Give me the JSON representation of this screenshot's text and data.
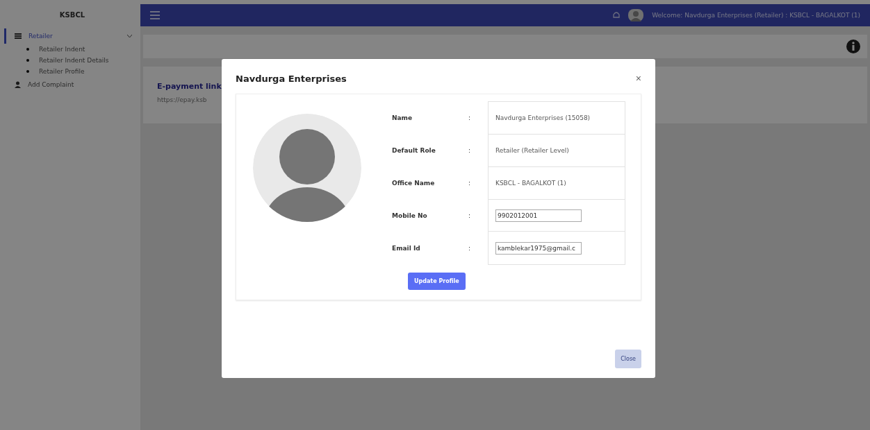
{
  "sidebar": {
    "brand": "KSBCL",
    "items": [
      {
        "label": "Retailer",
        "kind": "group",
        "expanded": true,
        "selected": true,
        "children": [
          {
            "label": "Retailer Indent"
          },
          {
            "label": "Retailer Indent Details"
          },
          {
            "label": "Retailer Profile"
          }
        ]
      },
      {
        "label": "Add Complaint",
        "kind": "link",
        "selected": false
      }
    ]
  },
  "topbar": {
    "welcome": "Welcome: Navdurga Enterprises (Retailer) : KSBCL - BAGALKOT (1)"
  },
  "card": {
    "title": "E-payment link",
    "link": "https://epay.ksb"
  },
  "modal": {
    "title": "Navdurga Enterprises",
    "close": "×",
    "fields": [
      {
        "label": "Name",
        "sep": ":",
        "kind": "text",
        "value": "Navdurga Enterprises (15058)"
      },
      {
        "label": "Default Role",
        "sep": ":",
        "kind": "text",
        "value": "Retailer (Retailer Level)"
      },
      {
        "label": "Office Name",
        "sep": ":",
        "kind": "text",
        "value": "KSBCL - BAGALKOT (1)"
      },
      {
        "label": "Mobile No",
        "sep": ":",
        "kind": "input",
        "value": "9902012001"
      },
      {
        "label": "Email Id",
        "sep": ":",
        "kind": "input",
        "value": "kamblekar1975@gmail.c"
      }
    ],
    "update_button": "Update Profile",
    "close_button": "Close"
  }
}
